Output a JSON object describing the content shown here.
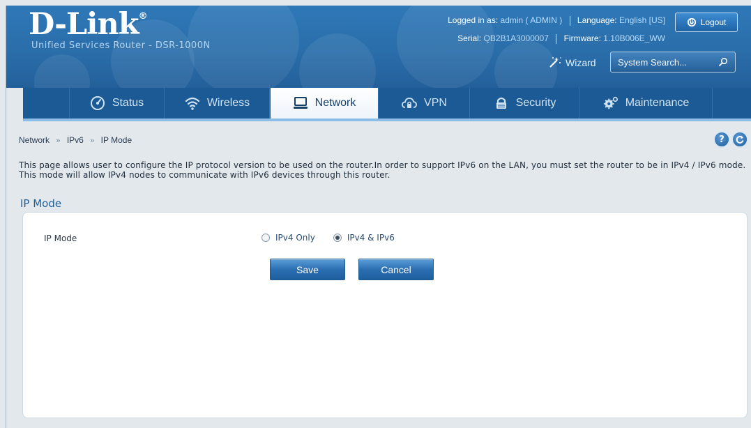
{
  "brand": {
    "logo": "D-Link",
    "registered": "®",
    "product": "Unified Services Router - DSR-1000N"
  },
  "header": {
    "logged_in_label": "Logged in as:",
    "user": "admin ( ADMIN )",
    "language_label": "Language:",
    "language": "English [US]",
    "serial_label": "Serial:",
    "serial": "QB2B1A3000007",
    "firmware_label": "Firmware:",
    "firmware": "1.10B006E_WW",
    "logout_label": "Logout",
    "wizard_label": "Wizard",
    "search_placeholder": "System Search..."
  },
  "nav": {
    "items": [
      {
        "label": "Status",
        "icon": "dashboard-icon"
      },
      {
        "label": "Wireless",
        "icon": "wifi-icon"
      },
      {
        "label": "Network",
        "icon": "computer-icon",
        "active": true
      },
      {
        "label": "VPN",
        "icon": "cloud-lock-icon"
      },
      {
        "label": "Security",
        "icon": "lock-icon"
      },
      {
        "label": "Maintenance",
        "icon": "gears-icon"
      }
    ]
  },
  "breadcrumb": {
    "items": [
      "Network",
      "IPv6",
      "IP Mode"
    ],
    "separator": "»"
  },
  "page": {
    "description": "This page allows user to configure the IP protocol version to be used on the router.In order to support IPv6 on the LAN, you must set the router to be in IPv4 / IPv6 mode. This mode will allow IPv4 nodes to communicate with IPv6 devices through this router.",
    "section_title": "IP Mode"
  },
  "form": {
    "ip_mode_label": "IP Mode",
    "options": [
      {
        "label": "IPv4 Only",
        "selected": false
      },
      {
        "label": "IPv4 & IPv6",
        "selected": true
      }
    ],
    "save_label": "Save",
    "cancel_label": "Cancel"
  },
  "colors": {
    "header": "#2a6eaa",
    "nav": "#1b5a94",
    "accent": "#1f5f98"
  }
}
